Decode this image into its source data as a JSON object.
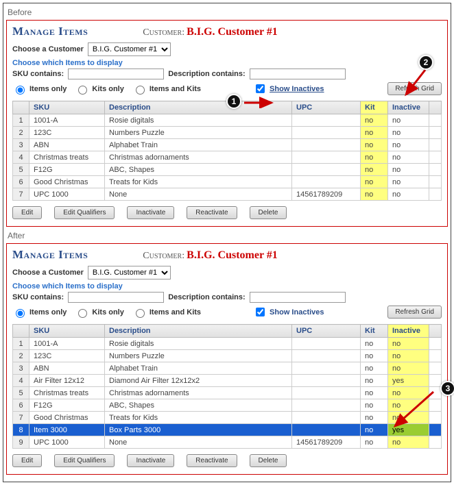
{
  "labels": {
    "before": "Before",
    "after": "After",
    "title": "Manage Items",
    "customer_lbl": "Customer:",
    "customer_name": "B.I.G. Customer #1",
    "choose_customer": "Choose a Customer",
    "choose_items": "Choose which Items to display",
    "sku_contains": "SKU contains:",
    "desc_contains": "Description contains:",
    "items_only": "Items only",
    "kits_only": "Kits only",
    "items_and_kits": "Items and Kits",
    "show_inactives": "Show Inactives",
    "refresh": "Refresh Grid",
    "edit": "Edit",
    "edit_qual": "Edit Qualifiers",
    "inactivate": "Inactivate",
    "reactivate": "Reactivate",
    "delete": "Delete"
  },
  "dropdown": {
    "selected": "B.I.G. Customer #1"
  },
  "cols": {
    "sku": "SKU",
    "desc": "Description",
    "upc": "UPC",
    "kit": "Kit",
    "inactive": "Inactive"
  },
  "before_rows": [
    {
      "n": "1",
      "sku": "1001-A",
      "desc": "Rosie digitals",
      "upc": "",
      "kit": "no",
      "inactive": "no"
    },
    {
      "n": "2",
      "sku": "123C",
      "desc": "Numbers Puzzle",
      "upc": "",
      "kit": "no",
      "inactive": "no"
    },
    {
      "n": "3",
      "sku": "ABN",
      "desc": "Alphabet Train",
      "upc": "",
      "kit": "no",
      "inactive": "no"
    },
    {
      "n": "4",
      "sku": "Christmas treats",
      "desc": "Christmas adornaments",
      "upc": "",
      "kit": "no",
      "inactive": "no"
    },
    {
      "n": "5",
      "sku": "F12G",
      "desc": "ABC, Shapes",
      "upc": "",
      "kit": "no",
      "inactive": "no"
    },
    {
      "n": "6",
      "sku": "Good Christmas",
      "desc": "Treats for Kids",
      "upc": "",
      "kit": "no",
      "inactive": "no"
    },
    {
      "n": "7",
      "sku": "UPC 1000",
      "desc": "None",
      "upc": "14561789209",
      "kit": "no",
      "inactive": "no"
    }
  ],
  "after_rows": [
    {
      "n": "1",
      "sku": "1001-A",
      "desc": "Rosie digitals",
      "upc": "",
      "kit": "no",
      "inactive": "no"
    },
    {
      "n": "2",
      "sku": "123C",
      "desc": "Numbers Puzzle",
      "upc": "",
      "kit": "no",
      "inactive": "no"
    },
    {
      "n": "3",
      "sku": "ABN",
      "desc": "Alphabet Train",
      "upc": "",
      "kit": "no",
      "inactive": "no"
    },
    {
      "n": "4",
      "sku": "Air Filter 12x12",
      "desc": "Diamond Air Filter 12x12x2",
      "upc": "",
      "kit": "no",
      "inactive": "yes"
    },
    {
      "n": "5",
      "sku": "Christmas treats",
      "desc": "Christmas adornaments",
      "upc": "",
      "kit": "no",
      "inactive": "no"
    },
    {
      "n": "6",
      "sku": "F12G",
      "desc": "ABC, Shapes",
      "upc": "",
      "kit": "no",
      "inactive": "no"
    },
    {
      "n": "7",
      "sku": "Good Christmas",
      "desc": "Treats for Kids",
      "upc": "",
      "kit": "no",
      "inactive": "no"
    },
    {
      "n": "8",
      "sku": "Item 3000",
      "desc": "Box Parts 3000",
      "upc": "",
      "kit": "no",
      "inactive": "yes",
      "selected": true,
      "hl_inactive": true
    },
    {
      "n": "9",
      "sku": "UPC 1000",
      "desc": "None",
      "upc": "14561789209",
      "kit": "no",
      "inactive": "no"
    }
  ],
  "callouts": {
    "c1": "1",
    "c2": "2",
    "c3": "3"
  }
}
